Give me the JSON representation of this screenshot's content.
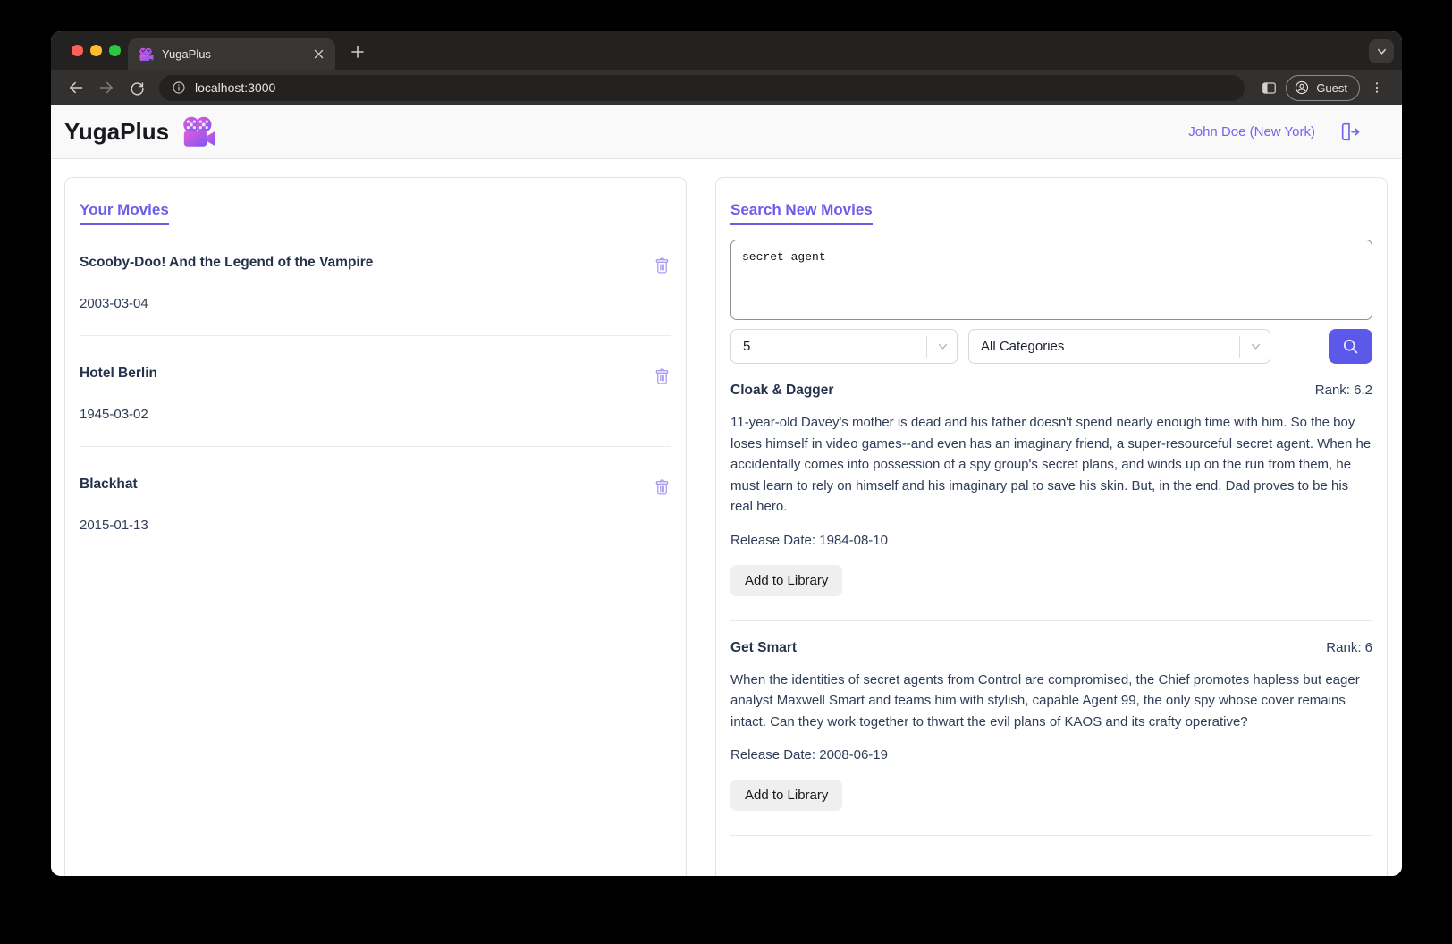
{
  "browser": {
    "tab_title": "YugaPlus",
    "url": "localhost:3000",
    "profile_label": "Guest"
  },
  "header": {
    "brand": "YugaPlus",
    "user": "John Doe (New York)"
  },
  "library": {
    "title": "Your Movies",
    "movies": [
      {
        "title": "Scooby-Doo! And the Legend of the Vampire",
        "date": "2003-03-04"
      },
      {
        "title": "Hotel Berlin",
        "date": "1945-03-02"
      },
      {
        "title": "Blackhat",
        "date": "2015-01-13"
      }
    ]
  },
  "search": {
    "title": "Search New Movies",
    "query": "secret agent",
    "limit_value": "5",
    "category_value": "All Categories",
    "rank_label": "Rank:",
    "release_date_label": "Release Date:",
    "add_button_label": "Add to Library",
    "results": [
      {
        "title": "Cloak & Dagger",
        "rank": "6.2",
        "description": "11-year-old Davey's mother is dead and his father doesn't spend nearly enough time with him. So the boy loses himself in video games--and even has an imaginary friend, a super-resourceful secret agent. When he accidentally comes into possession of a spy group's secret plans, and winds up on the run from them, he must learn to rely on himself and his imaginary pal to save his skin. But, in the end, Dad proves to be his real hero.",
        "release_date": "1984-08-10"
      },
      {
        "title": "Get Smart",
        "rank": "6",
        "description": "When the identities of secret agents from Control are compromised, the Chief promotes hapless but eager analyst Maxwell Smart and teams him with stylish, capable Agent 99, the only spy whose cover remains intact. Can they work together to thwart the evil plans of KAOS and its crafty operative?",
        "release_date": "2008-06-19"
      }
    ]
  },
  "colors": {
    "accent_purple": "#6c5ce7",
    "link_purple": "#7165ee",
    "search_button": "#5b58ea",
    "trash_icon": "#a89df3",
    "text_dark": "#2f3d58"
  },
  "icons": [
    "movie-camera-icon",
    "logout-icon",
    "trash-icon",
    "search-icon",
    "chevron-down-icon",
    "info-icon",
    "back-icon",
    "forward-icon",
    "reload-icon",
    "side-panel-icon",
    "person-icon",
    "kebab-menu-icon",
    "plus-icon",
    "close-icon"
  ]
}
